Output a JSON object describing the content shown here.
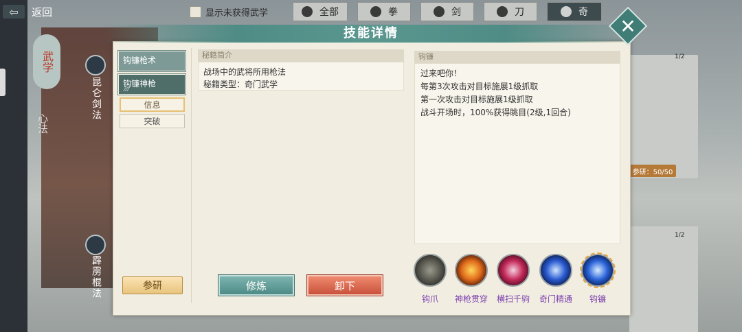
{
  "topbar": {
    "back_label": "返回",
    "show_unacquired_label": "显示未获得武学",
    "filters": [
      {
        "label": "全部",
        "icon": "bag-icon"
      },
      {
        "label": "拳",
        "icon": "fist-icon"
      },
      {
        "label": "剑",
        "icon": "sword-icon"
      },
      {
        "label": "刀",
        "icon": "blade-icon"
      },
      {
        "label": "奇",
        "icon": "shuriken-icon",
        "active": true
      }
    ]
  },
  "left_nav": {
    "martial_badge": "武学",
    "heart_method": "心法",
    "school_1": "昆仑剑法",
    "school_2": "霹雳棍法"
  },
  "background_cards": {
    "research_pill": "参研：50/50",
    "count_1": "1/2",
    "count_2": "1/2"
  },
  "modal": {
    "title": "技能详情",
    "skill_list": [
      {
        "label": "钩镰枪术",
        "selected": false
      },
      {
        "label": "钩镰神枪",
        "selected": true,
        "marks": "⁄⁄⁄"
      }
    ],
    "subtabs": [
      {
        "label": "信息",
        "active": true
      },
      {
        "label": "突破",
        "active": false
      }
    ],
    "research_button": "参研",
    "intro_header": "秘籍简介",
    "intro_line_1": "战场中的武将所用枪法",
    "intro_line_2": "秘籍类型：奇门武学",
    "train_button": "修炼",
    "unload_button": "卸下",
    "skill_header": "钩镰",
    "description": {
      "line_1": "过来吧你！",
      "line_2": "每第3次攻击对目标施展1级抓取",
      "line_3": "第一次攻击对目标施展1级抓取",
      "line_4": "战斗开场时，100%获得眺目(2级,1回合)"
    },
    "skills": [
      {
        "label": "钩爪",
        "icon": "claw-icon"
      },
      {
        "label": "神枪贯穿",
        "icon": "spear-pierce-icon"
      },
      {
        "label": "横扫千驹",
        "icon": "sweep-icon"
      },
      {
        "label": "奇门精通",
        "icon": "mastery-icon"
      },
      {
        "label": "钩镰",
        "icon": "hook-sickle-icon",
        "selected": true
      }
    ]
  }
}
